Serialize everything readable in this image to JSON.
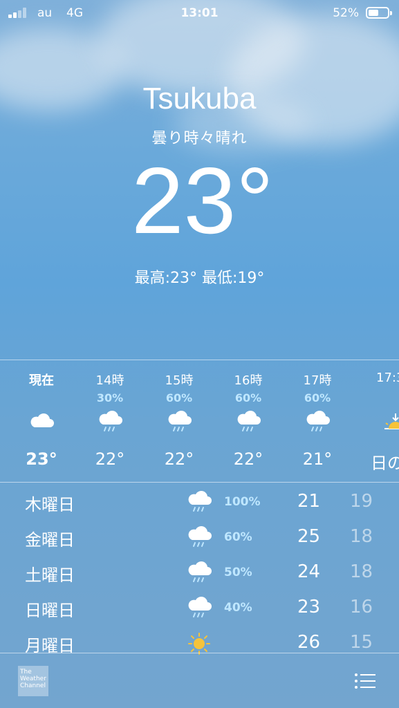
{
  "status_bar": {
    "carrier": "au",
    "network": "4G",
    "time": "13:01",
    "battery_percent": "52%",
    "battery_level": 0.52,
    "signal_bars": 2
  },
  "location": {
    "city": "Tsukuba",
    "condition": "曇り時々晴れ",
    "temperature": "23°",
    "high_low": "最高:23° 最低:19°"
  },
  "hourly": [
    {
      "label": "現在",
      "pct": "",
      "icon": "cloud-icon",
      "temp": "23°",
      "bold": true
    },
    {
      "label": "14時",
      "pct": "30%",
      "icon": "rain-cloud-icon",
      "temp": "22°"
    },
    {
      "label": "15時",
      "pct": "60%",
      "icon": "rain-cloud-icon",
      "temp": "22°"
    },
    {
      "label": "16時",
      "pct": "60%",
      "icon": "rain-cloud-icon",
      "temp": "22°"
    },
    {
      "label": "17時",
      "pct": "60%",
      "icon": "rain-cloud-icon",
      "temp": "21°"
    },
    {
      "label": "17:3",
      "pct": "",
      "icon": "sunset-icon",
      "temp": "日の"
    }
  ],
  "daily": [
    {
      "day": "木曜日",
      "icon": "rain-cloud-icon",
      "pct": "100%",
      "high": "21",
      "low": "19"
    },
    {
      "day": "金曜日",
      "icon": "rain-cloud-icon",
      "pct": "60%",
      "high": "25",
      "low": "18"
    },
    {
      "day": "土曜日",
      "icon": "rain-cloud-icon",
      "pct": "50%",
      "high": "24",
      "low": "18"
    },
    {
      "day": "日曜日",
      "icon": "rain-cloud-icon",
      "pct": "40%",
      "high": "23",
      "low": "16"
    },
    {
      "day": "月曜日",
      "icon": "sun-icon",
      "pct": "",
      "high": "26",
      "low": "15"
    }
  ],
  "footer": {
    "logo_text": [
      "The",
      "Weather",
      "Channel"
    ],
    "list_icon": "list-icon"
  },
  "colors": {
    "sun": "#f6c33a",
    "percent": "#bfe7ff"
  }
}
